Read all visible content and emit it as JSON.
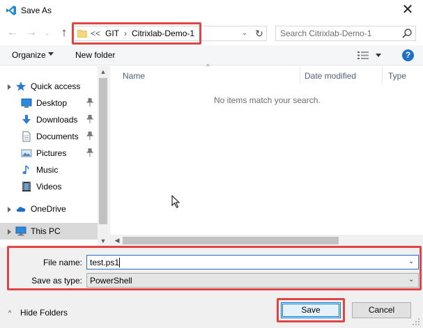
{
  "window": {
    "title": "Save As",
    "close_glyph": "✕",
    "app_icon": "vscode-icon"
  },
  "nav": {
    "back_glyph": "←",
    "forward_glyph": "→",
    "recent_glyph": "⌄",
    "up_glyph": "↑"
  },
  "address": {
    "overflow": "<<",
    "crumbs": [
      "GIT",
      "Citrixlab-Demo-1"
    ],
    "separator": "›",
    "dropdown_glyph": "⌄",
    "refresh_glyph": "↻"
  },
  "search": {
    "placeholder": "Search Citrixlab-Demo-1"
  },
  "toolbar": {
    "organize_label": "Organize",
    "new_folder_label": "New folder",
    "help_glyph": "?"
  },
  "sidebar": {
    "items": [
      {
        "label": "Quick access",
        "icon": "star-icon",
        "pinned": false
      },
      {
        "label": "Desktop",
        "icon": "desktop-icon",
        "pinned": true
      },
      {
        "label": "Downloads",
        "icon": "download-icon",
        "pinned": true
      },
      {
        "label": "Documents",
        "icon": "documents-icon",
        "pinned": true
      },
      {
        "label": "Pictures",
        "icon": "pictures-icon",
        "pinned": true
      },
      {
        "label": "Music",
        "icon": "music-icon",
        "pinned": false
      },
      {
        "label": "Videos",
        "icon": "videos-icon",
        "pinned": false
      },
      {
        "label": "OneDrive",
        "icon": "cloud-icon",
        "pinned": false
      },
      {
        "label": "This PC",
        "icon": "computer-icon",
        "pinned": false
      }
    ],
    "pin_glyph": "📌"
  },
  "filelist": {
    "columns": [
      "Name",
      "Date modified",
      "Type"
    ],
    "sort_glyph": "^",
    "empty_message": "No items match your search."
  },
  "form": {
    "filename_label": "File name:",
    "filename_value": "test.ps1",
    "savetype_label": "Save as type:",
    "savetype_value": "PowerShell",
    "dropdown_glyph": "⌄"
  },
  "footer": {
    "hide_folders_label": "Hide Folders",
    "hide_glyph": "^",
    "save_label": "Save",
    "cancel_label": "Cancel"
  },
  "colors": {
    "highlight": "#e04545",
    "accent": "#0078d7",
    "help": "#1f6fc5"
  }
}
